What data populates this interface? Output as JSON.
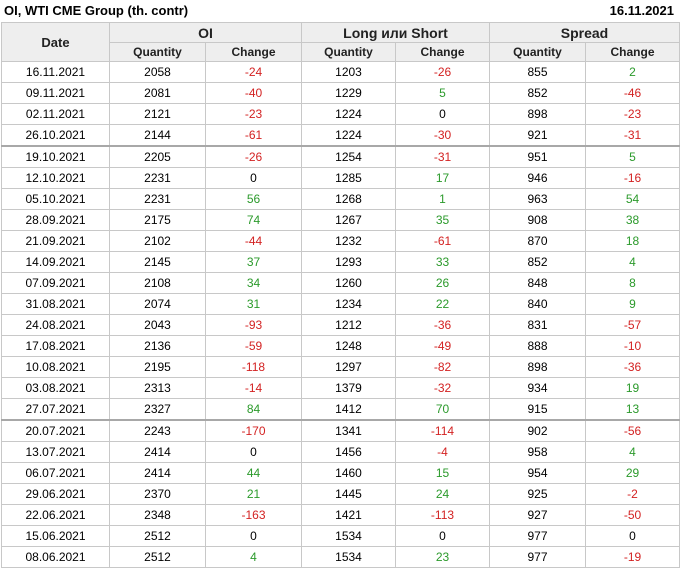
{
  "header": {
    "title": "OI, WTI CME Group (th. contr)",
    "date": "16.11.2021"
  },
  "table": {
    "date_col": "Date",
    "groups": [
      "OI",
      "Long или Short",
      "Spread"
    ],
    "sub_cols": [
      "Quantity",
      "Change"
    ],
    "rows": [
      {
        "date": "16.11.2021",
        "oi_q": "2058",
        "oi_c": "-24",
        "ls_q": "1203",
        "ls_c": "-26",
        "sp_q": "855",
        "sp_c": "2"
      },
      {
        "date": "09.11.2021",
        "oi_q": "2081",
        "oi_c": "-40",
        "ls_q": "1229",
        "ls_c": "5",
        "sp_q": "852",
        "sp_c": "-46"
      },
      {
        "date": "02.11.2021",
        "oi_q": "2121",
        "oi_c": "-23",
        "ls_q": "1224",
        "ls_c": "0",
        "sp_q": "898",
        "sp_c": "-23"
      },
      {
        "date": "26.10.2021",
        "oi_q": "2144",
        "oi_c": "-61",
        "ls_q": "1224",
        "ls_c": "-30",
        "sp_q": "921",
        "sp_c": "-31"
      },
      {
        "date": "19.10.2021",
        "oi_q": "2205",
        "oi_c": "-26",
        "ls_q": "1254",
        "ls_c": "-31",
        "sp_q": "951",
        "sp_c": "5"
      },
      {
        "date": "12.10.2021",
        "oi_q": "2231",
        "oi_c": "0",
        "ls_q": "1285",
        "ls_c": "17",
        "sp_q": "946",
        "sp_c": "-16"
      },
      {
        "date": "05.10.2021",
        "oi_q": "2231",
        "oi_c": "56",
        "ls_q": "1268",
        "ls_c": "1",
        "sp_q": "963",
        "sp_c": "54"
      },
      {
        "date": "28.09.2021",
        "oi_q": "2175",
        "oi_c": "74",
        "ls_q": "1267",
        "ls_c": "35",
        "sp_q": "908",
        "sp_c": "38"
      },
      {
        "date": "21.09.2021",
        "oi_q": "2102",
        "oi_c": "-44",
        "ls_q": "1232",
        "ls_c": "-61",
        "sp_q": "870",
        "sp_c": "18"
      },
      {
        "date": "14.09.2021",
        "oi_q": "2145",
        "oi_c": "37",
        "ls_q": "1293",
        "ls_c": "33",
        "sp_q": "852",
        "sp_c": "4"
      },
      {
        "date": "07.09.2021",
        "oi_q": "2108",
        "oi_c": "34",
        "ls_q": "1260",
        "ls_c": "26",
        "sp_q": "848",
        "sp_c": "8"
      },
      {
        "date": "31.08.2021",
        "oi_q": "2074",
        "oi_c": "31",
        "ls_q": "1234",
        "ls_c": "22",
        "sp_q": "840",
        "sp_c": "9"
      },
      {
        "date": "24.08.2021",
        "oi_q": "2043",
        "oi_c": "-93",
        "ls_q": "1212",
        "ls_c": "-36",
        "sp_q": "831",
        "sp_c": "-57"
      },
      {
        "date": "17.08.2021",
        "oi_q": "2136",
        "oi_c": "-59",
        "ls_q": "1248",
        "ls_c": "-49",
        "sp_q": "888",
        "sp_c": "-10"
      },
      {
        "date": "10.08.2021",
        "oi_q": "2195",
        "oi_c": "-118",
        "ls_q": "1297",
        "ls_c": "-82",
        "sp_q": "898",
        "sp_c": "-36"
      },
      {
        "date": "03.08.2021",
        "oi_q": "2313",
        "oi_c": "-14",
        "ls_q": "1379",
        "ls_c": "-32",
        "sp_q": "934",
        "sp_c": "19"
      },
      {
        "date": "27.07.2021",
        "oi_q": "2327",
        "oi_c": "84",
        "ls_q": "1412",
        "ls_c": "70",
        "sp_q": "915",
        "sp_c": "13"
      },
      {
        "date": "20.07.2021",
        "oi_q": "2243",
        "oi_c": "-170",
        "ls_q": "1341",
        "ls_c": "-114",
        "sp_q": "902",
        "sp_c": "-56"
      },
      {
        "date": "13.07.2021",
        "oi_q": "2414",
        "oi_c": "0",
        "ls_q": "1456",
        "ls_c": "-4",
        "sp_q": "958",
        "sp_c": "4"
      },
      {
        "date": "06.07.2021",
        "oi_q": "2414",
        "oi_c": "44",
        "ls_q": "1460",
        "ls_c": "15",
        "sp_q": "954",
        "sp_c": "29"
      },
      {
        "date": "29.06.2021",
        "oi_q": "2370",
        "oi_c": "21",
        "ls_q": "1445",
        "ls_c": "24",
        "sp_q": "925",
        "sp_c": "-2"
      },
      {
        "date": "22.06.2021",
        "oi_q": "2348",
        "oi_c": "-163",
        "ls_q": "1421",
        "ls_c": "-113",
        "sp_q": "927",
        "sp_c": "-50"
      },
      {
        "date": "15.06.2021",
        "oi_q": "2512",
        "oi_c": "0",
        "ls_q": "1534",
        "ls_c": "0",
        "sp_q": "977",
        "sp_c": "0"
      },
      {
        "date": "08.06.2021",
        "oi_q": "2512",
        "oi_c": "4",
        "ls_q": "1534",
        "ls_c": "23",
        "sp_q": "977",
        "sp_c": "-19"
      }
    ]
  },
  "colors": {
    "positive": "#2b9a2b",
    "negative": "#d32222",
    "neutral": "#000000",
    "header_bg": "#eeeeee"
  }
}
